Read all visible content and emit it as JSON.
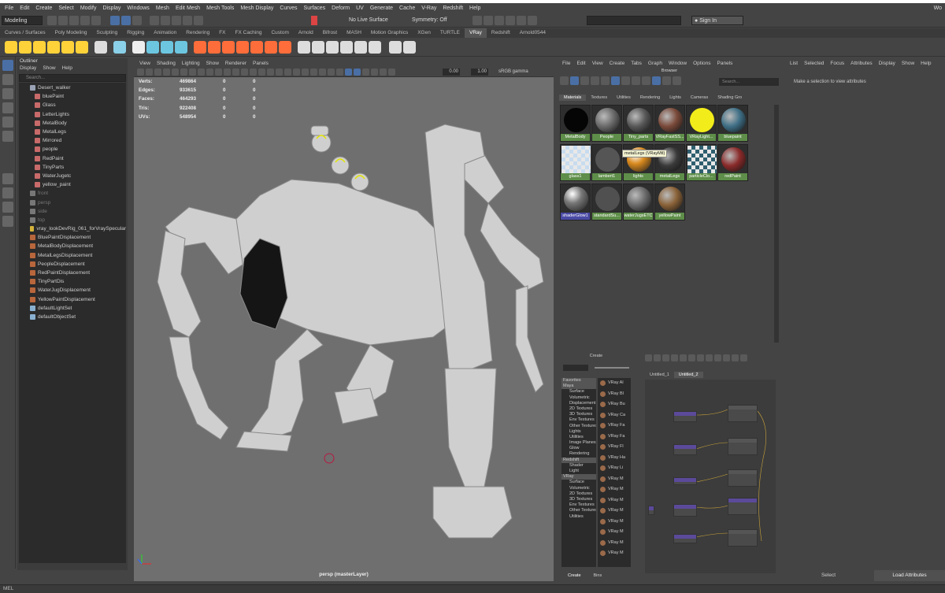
{
  "menubar": {
    "items": [
      "File",
      "Edit",
      "Create",
      "Select",
      "Modify",
      "Display",
      "Windows",
      "Mesh",
      "Edit Mesh",
      "Mesh Tools",
      "Mesh Display",
      "Curves",
      "Surfaces",
      "Deform",
      "UV",
      "Generate",
      "Cache",
      "V-Ray",
      "Redshift",
      "Help"
    ],
    "workspace_label": "Wo"
  },
  "status": {
    "menuset": "Modeling",
    "live_surface": "No Live Surface",
    "symmetry": "Symmetry: Off",
    "signin": "Sign In"
  },
  "shelf_tabs": [
    "Curves / Surfaces",
    "Poly Modeling",
    "Sculpting",
    "Rigging",
    "Animation",
    "Rendering",
    "FX",
    "FX Caching",
    "Custom",
    "Arnold",
    "Bifrost",
    "MASH",
    "Motion Graphics",
    "XGen",
    "TURTLE",
    "VRay",
    "Redshift",
    "Arnold0544"
  ],
  "shelf_active": "VRay",
  "outliner": {
    "title": "Outliner",
    "menu": [
      "Display",
      "Show",
      "Help"
    ],
    "search_placeholder": "Search...",
    "items": [
      {
        "label": "Desert_walker",
        "color": "#9aa3b5"
      },
      {
        "label": "bluePaint",
        "color": "#c96a6a"
      },
      {
        "label": "Glass",
        "color": "#c96a6a"
      },
      {
        "label": "LetterLights",
        "color": "#c96a6a"
      },
      {
        "label": "MetalBody",
        "color": "#c96a6a"
      },
      {
        "label": "MetalLegs",
        "color": "#c96a6a"
      },
      {
        "label": "Mirrored",
        "color": "#c96a6a"
      },
      {
        "label": "people",
        "color": "#c96a6a"
      },
      {
        "label": "RedPaint",
        "color": "#c96a6a"
      },
      {
        "label": "TinyParts",
        "color": "#c96a6a"
      },
      {
        "label": "WaterJugetc",
        "color": "#c96a6a"
      },
      {
        "label": "yellow_paint",
        "color": "#c96a6a"
      },
      {
        "label": "front",
        "color": "#777",
        "dim": true
      },
      {
        "label": "persp",
        "color": "#777",
        "dim": true
      },
      {
        "label": "side",
        "color": "#777",
        "dim": true
      },
      {
        "label": "top",
        "color": "#777",
        "dim": true
      },
      {
        "label": "vray_lookDevRig_061_forVraySpecular",
        "color": "#d4b23a"
      },
      {
        "label": "BluePaintDisplacement",
        "color": "#b8663c"
      },
      {
        "label": "MetalBodyDisplacement",
        "color": "#b8663c"
      },
      {
        "label": "MetalLegsDisplacement",
        "color": "#b8663c"
      },
      {
        "label": "PeopleDisplacement",
        "color": "#b8663c"
      },
      {
        "label": "RedPaintDisplacement",
        "color": "#b8663c"
      },
      {
        "label": "TinyPartDis",
        "color": "#b8663c"
      },
      {
        "label": "WaterJugDisplacement",
        "color": "#b8663c"
      },
      {
        "label": "YellowPaintDisplacement",
        "color": "#b8663c"
      },
      {
        "label": "defaultLightSet",
        "color": "#8ab0d0"
      },
      {
        "label": "defaultObjectSet",
        "color": "#8ab0d0"
      }
    ]
  },
  "viewport": {
    "menu": [
      "View",
      "Shading",
      "Lighting",
      "Show",
      "Renderer",
      "Panels"
    ],
    "exposure": "0.00",
    "gamma": "1.00",
    "colorspace": "sRGB gamma",
    "hud": [
      {
        "k": "Verts:",
        "v": "469864",
        "a": "0",
        "b": "0"
      },
      {
        "k": "Edges:",
        "v": "933615",
        "a": "0",
        "b": "0"
      },
      {
        "k": "Faces:",
        "v": "464293",
        "a": "0",
        "b": "0"
      },
      {
        "k": "Tris:",
        "v": "922408",
        "a": "0",
        "b": "0"
      },
      {
        "k": "UVs:",
        "v": "548954",
        "a": "0",
        "b": "0"
      }
    ],
    "camera_label": "persp (masterLayer)"
  },
  "hypershade": {
    "menu": [
      "File",
      "Edit",
      "View",
      "Create",
      "Tabs",
      "Graph",
      "Window",
      "Options",
      "Panels"
    ],
    "browser_title": "Browser",
    "search_placeholder": "Search...",
    "tabs": [
      "Materials",
      "Textures",
      "Utilities",
      "Rendering",
      "Lights",
      "Cameras",
      "Shading Gro"
    ],
    "materials": [
      {
        "name": "MetalBody",
        "color": "#050505",
        "style": "solid"
      },
      {
        "name": "People",
        "color": "#6a6a6a",
        "style": "noise"
      },
      {
        "name": "Tiny_parts",
        "color": "#585858",
        "style": "noise"
      },
      {
        "name": "VRayFastSS...",
        "color": "#7a4a3a",
        "style": "noise"
      },
      {
        "name": "VRayLight...",
        "color": "#f2ec1a",
        "style": "solid"
      },
      {
        "name": "bluepaint",
        "color": "#3f6f86",
        "style": "noise"
      },
      {
        "name": "glass1",
        "color": "#c8dcef",
        "style": "checker"
      },
      {
        "name": "lambert1",
        "color": "#555555",
        "style": "solid"
      },
      {
        "name": "lights",
        "color": "#d98a1e",
        "style": "glossy"
      },
      {
        "name": "metalLegs",
        "color": "#3a3a3a",
        "style": "noise"
      },
      {
        "name": "particleClo...",
        "color": "#2f5f6f",
        "style": "checker"
      },
      {
        "name": "redPaint",
        "color": "#8a2a2a",
        "style": "noise"
      },
      {
        "name": "shaderGlow1",
        "color": "#777777",
        "style": "glossy"
      },
      {
        "name": "standardSu...",
        "color": "#505050",
        "style": "solid"
      },
      {
        "name": "waterJugsETC",
        "color": "#6a6a6a",
        "style": "noise"
      },
      {
        "name": "yellowPaint",
        "color": "#8a6238",
        "style": "noise"
      }
    ],
    "tooltip": "metalLegs (VRayMtl)",
    "create_title": "Create",
    "create_tree": [
      "Favorites",
      "Maya",
      "Surface",
      "Volumetric",
      "Displacement",
      "2D Textures",
      "3D Textures",
      "Env Textures",
      "Other Textures",
      "Lights",
      "Utilities",
      "Image Planes",
      "Glow",
      "Rendering",
      "Redshift",
      "Shader",
      "Light",
      "VRay",
      "Surface",
      "Volumetric",
      "2D Textures",
      "3D Textures",
      "Env Textures",
      "Other Textures",
      "Utilities"
    ],
    "create_list": [
      "VRay Al",
      "VRay Bl",
      "VRay Bu",
      "VRay Ca",
      "VRay Fa",
      "VRay Fa",
      "VRay Fl",
      "VRay Ha",
      "VRay Li",
      "VRay M",
      "VRay M",
      "VRay M",
      "VRay M",
      "VRay M",
      "VRay M",
      "VRay M",
      "VRay M"
    ],
    "create_tabs": [
      "Create",
      "Bins"
    ],
    "node_tabs": [
      "Untitled_1",
      "Untitled_2"
    ]
  },
  "attribute_editor": {
    "menu": [
      "List",
      "Selected",
      "Focus",
      "Attributes",
      "Display",
      "Show",
      "Help"
    ],
    "message": "Make a selection to view attributes",
    "select_button": "Select",
    "load_button": "Load Attributes"
  },
  "help_line": "MEL"
}
